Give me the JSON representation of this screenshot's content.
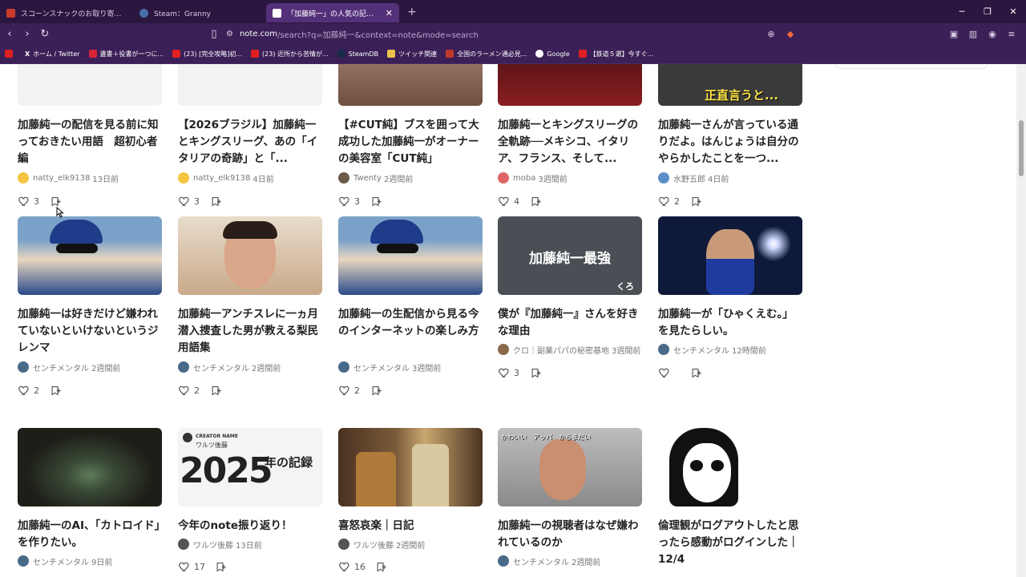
{
  "browser": {
    "tabs": [
      {
        "label": "スコーンスナックのお取り寄せ | 公式通販",
        "color": "#cc3a2b",
        "active": false
      },
      {
        "label": "Steam：Granny",
        "color": "#4a6fa5",
        "active": false
      },
      {
        "label": "「加藤純一」の人気の記事一覧｜note",
        "color": "#ffffff",
        "active": true
      }
    ],
    "url_host": "note.com",
    "url_path": "/search?q=加藤純一&context=note&mode=search",
    "bookmarks": [
      {
        "label": "",
        "color": "#e02020"
      },
      {
        "label": "ホーム / Twitter",
        "color": "#000000"
      },
      {
        "label": "遺書＋役書が一つに...",
        "color": "#d9243b"
      },
      {
        "label": "(23) [完全攻略]初...",
        "color": "#e02020"
      },
      {
        "label": "(23) 近所から苦情が...",
        "color": "#e02020"
      },
      {
        "label": "SteamDB",
        "color": "#1a2b4a"
      },
      {
        "label": "ツイッチ関連",
        "color": "#e8c24a"
      },
      {
        "label": "全国のラーメン通必見...",
        "color": "#c0392b"
      },
      {
        "label": "Google",
        "color": "#ffffff"
      },
      {
        "label": "【鉄道５選】今すぐ...",
        "color": "#e02020"
      }
    ]
  },
  "partial_row": [
    {
      "title": "加藤純一の配信を見る前に知っておきたい用語　超初心者編",
      "author": "natty_elk9138",
      "time": "13日前",
      "likes": "3",
      "avatar": "#f5c542",
      "thumb": "#f2f2f2"
    },
    {
      "title": "【2026ブラジル】加藤純一とキングスリーグ、あの「イタリアの奇跡」と「...",
      "author": "natty_elk9138",
      "time": "4日前",
      "likes": "3",
      "avatar": "#f5c542",
      "thumb": "#f2f2f2"
    },
    {
      "title": "【#CUT純】ブスを囲って大成功した加藤純一がオーナーの美容室「CUT純」",
      "author": "Twenty",
      "time": "2週間前",
      "likes": "3",
      "avatar": "#6b5a4a",
      "thumb": "#8a6e5a"
    },
    {
      "title": "加藤純一とキングスリーグの全軌跡──メキシコ、イタリア、フランス、そして...",
      "author": "moba",
      "time": "3週間前",
      "likes": "4",
      "avatar": "#e06666",
      "thumb": "#7a1e22"
    },
    {
      "title": "加藤純一さんが言っている通りだよ。はんじょうは自分のやらかしたことを一つ...",
      "author": "水野五郎",
      "time": "4日前",
      "likes": "2",
      "avatar": "#5b8fc7",
      "thumb": "#3a3a3a",
      "thumb_text": "正直言うと..."
    }
  ],
  "row2": [
    {
      "title": "加藤純一は好きだけど嫌われていないといけないというジレンマ",
      "author": "センチメンタル",
      "time": "2週間前",
      "likes": "2",
      "avatar": "#4a6a8a",
      "thumb": "#6a8cb0"
    },
    {
      "title": "加藤純一アンチスレに一ヵ月潜入捜査した男が教える梨民用語集",
      "author": "センチメンタル",
      "time": "2週間前",
      "likes": "2",
      "avatar": "#4a6a8a",
      "thumb": "#c8a78a"
    },
    {
      "title": "加藤純一の生配信から見る今のインターネットの楽しみ方",
      "author": "センチメンタル",
      "time": "3週間前",
      "likes": "2",
      "avatar": "#4a6a8a",
      "thumb": "#6a8cb0"
    },
    {
      "title": "僕が『加藤純一』さんを好きな理由",
      "author": "クロ｜副業パパの秘密基地",
      "time": "3週間前",
      "likes": "3",
      "avatar": "#8a6a4a",
      "thumb": "#4a4f55",
      "thumb_text": "加藤純一最強",
      "thumb_sub": "くろ"
    },
    {
      "title": "加藤純一が「ひゃくえむ。」を見たらしい。",
      "author": "センチメンタル",
      "time": "12時間前",
      "likes": "",
      "avatar": "#4a6a8a",
      "thumb": "#0f1a3a"
    }
  ],
  "row3": [
    {
      "title": "加藤純一のAI、「カトロイド」を作りたい。",
      "author": "センチメンタル",
      "time": "9日前",
      "likes": "",
      "avatar": "#4a6a8a",
      "thumb": "#2a2a22"
    },
    {
      "title": "今年のnote振り返り！",
      "author": "ワルツ後藤",
      "time": "13日前",
      "likes": "17",
      "avatar": "#555555",
      "thumb": "#f4f4f4",
      "thumb_creator": "CREATOR NAME",
      "thumb_name": "ワルツ後藤",
      "thumb_year": "2025",
      "thumb_kicker": "年の記録"
    },
    {
      "title": "喜怒哀楽｜日記",
      "author": "ワルツ後藤",
      "time": "2週間前",
      "likes": "16",
      "avatar": "#555555",
      "thumb": "#6a4a2a"
    },
    {
      "title": "加藤純一の視聴者はなぜ嫌われているのか",
      "author": "センチメンタル",
      "time": "2週間前",
      "likes": "",
      "avatar": "#4a6a8a",
      "thumb": "#9a9a9a",
      "thumb_text": "かわいい　アッパ　からまだい"
    },
    {
      "title": "倫理観がログアウトしたと思ったら感動がログインした｜12/4",
      "author": "",
      "time": "",
      "likes": "",
      "avatar": "#4a6a8a",
      "thumb": "#ffffff"
    }
  ]
}
